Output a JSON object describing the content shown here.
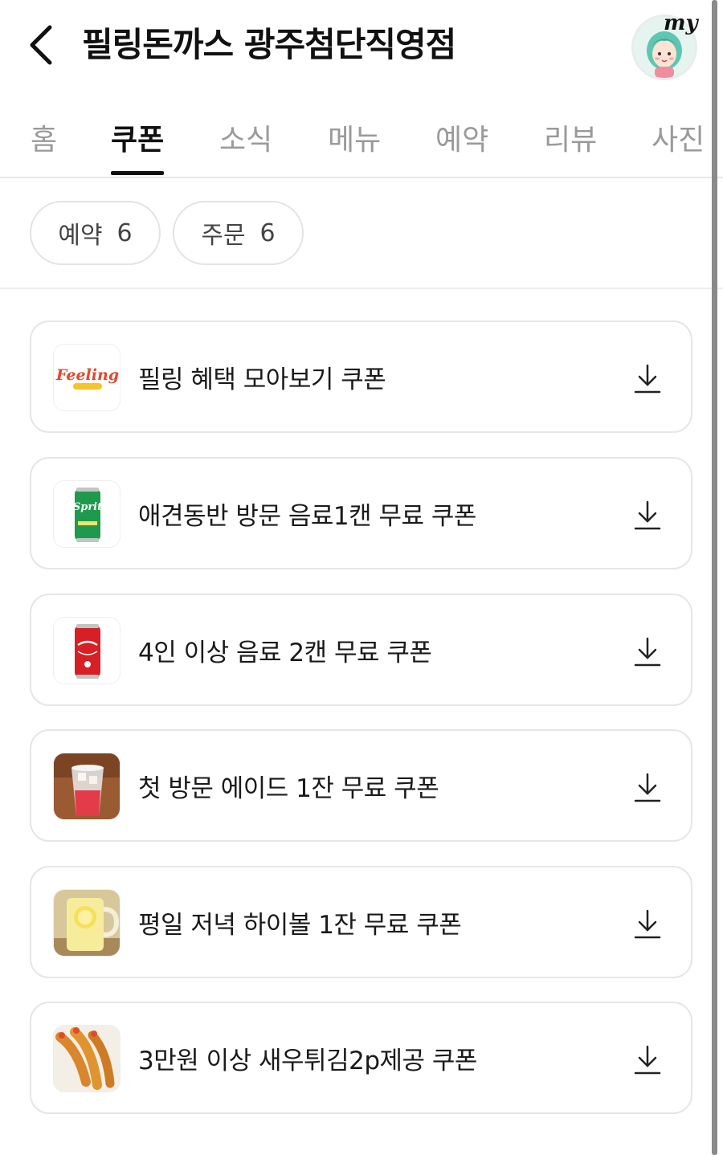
{
  "header": {
    "title": "필링돈까스 광주첨단직영점",
    "back_icon": "chevron-left-icon",
    "my_label": "my"
  },
  "tabs": [
    {
      "label": "홈",
      "active": false
    },
    {
      "label": "쿠폰",
      "active": true
    },
    {
      "label": "소식",
      "active": false
    },
    {
      "label": "메뉴",
      "active": false
    },
    {
      "label": "예약",
      "active": false
    },
    {
      "label": "리뷰",
      "active": false
    },
    {
      "label": "사진",
      "active": false
    }
  ],
  "filters": [
    {
      "label": "예약",
      "count": "6"
    },
    {
      "label": "주문",
      "count": "6"
    }
  ],
  "coupons": [
    {
      "title": "필링 혜택 모아보기 쿠폰",
      "thumb": "feeling-logo",
      "thumb_text": "Feeling"
    },
    {
      "title": "애견동반 방문 음료1캔 무료 쿠폰",
      "thumb": "sprite-can",
      "thumb_text": "Sprit"
    },
    {
      "title": "4인 이상 음료 2캔 무료 쿠폰",
      "thumb": "coke-can"
    },
    {
      "title": "첫 방문 에이드 1잔 무료 쿠폰",
      "thumb": "ade-cup"
    },
    {
      "title": "평일 저녁 하이볼 1잔 무료 쿠폰",
      "thumb": "highball-mug"
    },
    {
      "title": "3만원 이상 새우튀김2p제공 쿠폰",
      "thumb": "fried-shrimp"
    }
  ],
  "colors": {
    "accent_text": "#111111",
    "inactive_tab": "#9a9a9a",
    "border": "#e6e6e6"
  }
}
